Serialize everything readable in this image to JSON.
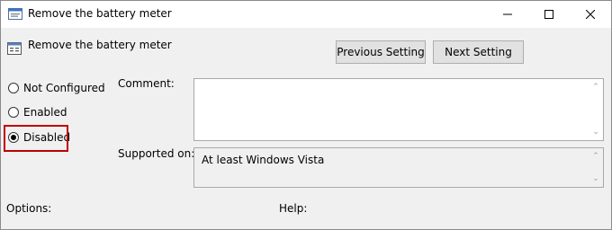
{
  "window": {
    "title": "Remove the battery meter"
  },
  "header": {
    "policy_name": "Remove the battery meter",
    "prev_label": "Previous Setting",
    "next_label": "Next Setting"
  },
  "options": {
    "not_configured": "Not Configured",
    "enabled": "Enabled",
    "disabled": "Disabled",
    "selected": "Disabled"
  },
  "fields": {
    "comment_label": "Comment:",
    "comment_value": "",
    "supported_label": "Supported on:",
    "supported_value": "At least Windows Vista"
  },
  "footer": {
    "options_label": "Options:",
    "help_label": "Help:"
  },
  "colors": {
    "highlight": "#c00000",
    "window_bg": "#f0f0f0"
  },
  "icons": [
    "policy-app-icon",
    "policy-setting-icon",
    "minimize-icon",
    "maximize-icon",
    "close-icon",
    "scroll-up-icon",
    "scroll-down-icon"
  ]
}
